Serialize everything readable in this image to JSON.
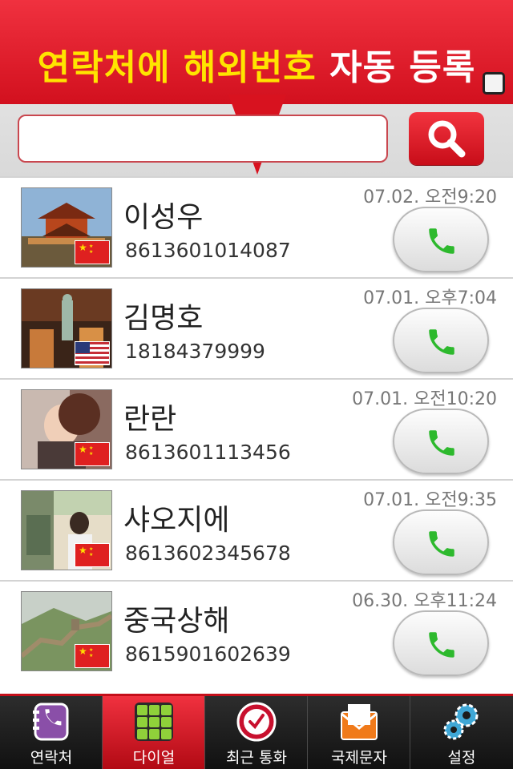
{
  "banner": {
    "title_highlight": "연락처에 해외번호",
    "title_rest": " 자동 등록"
  },
  "search": {
    "value": "",
    "placeholder": ""
  },
  "contacts": [
    {
      "name": "이성우",
      "phone": "8613601014087",
      "time": "07.02. 오전9:20",
      "flag": "china",
      "photo": "pagoda"
    },
    {
      "name": "김명호",
      "phone": "18184379999",
      "time": "07.01. 오후7:04",
      "flag": "usa",
      "photo": "statue-of-liberty"
    },
    {
      "name": "란란",
      "phone": "8613601113456",
      "time": "07.01. 오전10:20",
      "flag": "china",
      "photo": "girl-portrait"
    },
    {
      "name": "샤오지에",
      "phone": "8613602345678",
      "time": "07.01. 오전9:35",
      "flag": "china",
      "photo": "street-shop"
    },
    {
      "name": "중국상해",
      "phone": "8615901602639",
      "time": "06.30. 오후11:24",
      "flag": "china",
      "photo": "great-wall"
    }
  ],
  "tabs": [
    {
      "label": "연락처",
      "icon": "contacts-book-icon",
      "active": false
    },
    {
      "label": "다이얼",
      "icon": "dial-keypad-icon",
      "active": true
    },
    {
      "label": "최근 통화",
      "icon": "clock-icon",
      "active": false
    },
    {
      "label": "국제문자",
      "icon": "envelope-icon",
      "active": false
    },
    {
      "label": "설정",
      "icon": "gears-icon",
      "active": false
    }
  ],
  "colors": {
    "brand_red": "#e01f2b",
    "highlight_yellow": "#ffe400",
    "call_green": "#2db92d",
    "tabbar_dark": "#1e1e1e"
  }
}
